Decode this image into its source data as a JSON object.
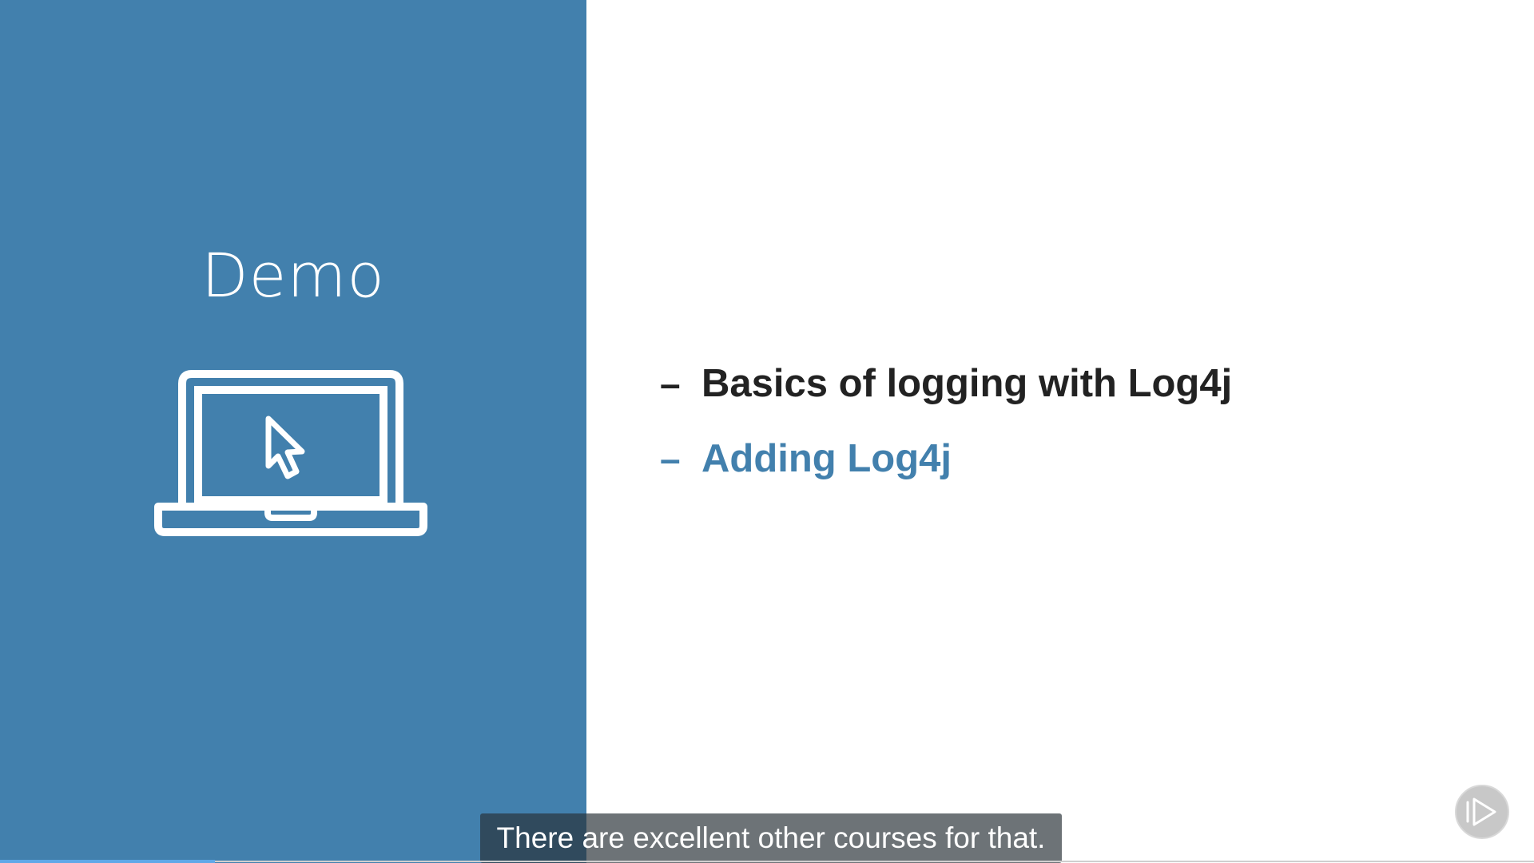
{
  "slide": {
    "section_title": "Demo",
    "bullets": [
      {
        "dash": "–",
        "text": "Basics of logging with Log4j"
      },
      {
        "dash": "–",
        "text": "Adding Log4j"
      }
    ]
  },
  "caption": {
    "text": "There are excellent other courses for that."
  },
  "icons": {
    "laptop": "laptop-cursor-icon",
    "player": "play-icon"
  },
  "colors": {
    "panel": "#4280ad",
    "bullet_active": "#4280ad",
    "bullet_default": "#222222"
  },
  "playback": {
    "progress": 0.14
  }
}
